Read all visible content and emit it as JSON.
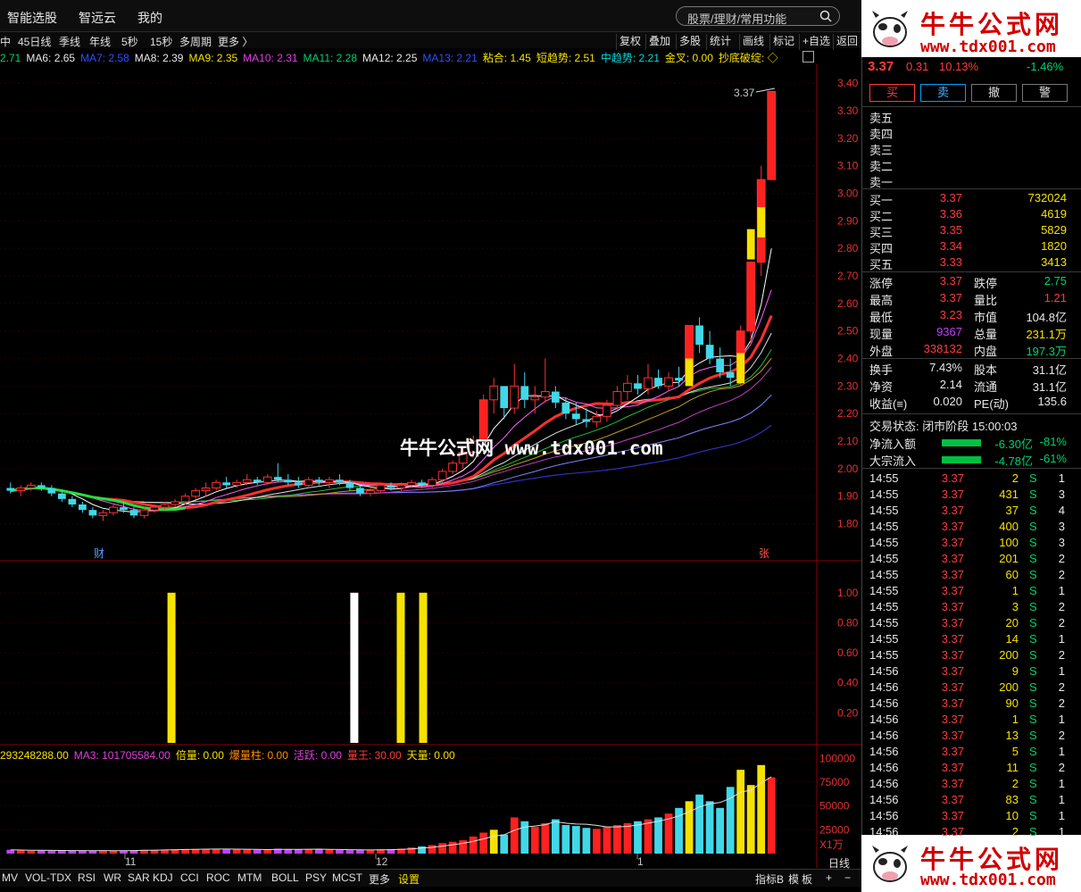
{
  "app": {
    "menus": [
      "智能选股",
      "智远云",
      "我的"
    ],
    "search_placeholder": "股票/理财/常用功能"
  },
  "periods": [
    "中",
    "45日线",
    "季线",
    "年线",
    "5秒",
    "15秒",
    "多周期",
    "更多 〉"
  ],
  "tools": [
    "复权",
    "叠加",
    "多股",
    "统计",
    "画线",
    "标记",
    "+自选",
    "返回"
  ],
  "ma_line": [
    {
      "text": "2.71",
      "color": "#00d070"
    },
    {
      "text": "MA6: 2.65",
      "color": "#e8e8e8"
    },
    {
      "text": "MA7: 2.58",
      "color": "#3050ff"
    },
    {
      "text": "MA8: 2.39",
      "color": "#e8e8e8"
    },
    {
      "text": "MA9: 2.35",
      "color": "#f5e200"
    },
    {
      "text": "MA10: 2.31",
      "color": "#e040e0"
    },
    {
      "text": "MA11: 2.28",
      "color": "#00d070"
    },
    {
      "text": "MA12: 2.25",
      "color": "#e8e8e8"
    },
    {
      "text": "MA13: 2.21",
      "color": "#3050ff"
    },
    {
      "text": "粘合: 1.45",
      "color": "#f5e200"
    },
    {
      "text": "短趋势: 2.51",
      "color": "#f5e200"
    },
    {
      "text": "中趋势: 2.21",
      "color": "#00d8d8"
    },
    {
      "text": "金叉: 0.00",
      "color": "#f5e200"
    },
    {
      "text": "抄底破绽: ◇",
      "color": "#f5e200"
    }
  ],
  "price_axis": [
    "3.40",
    "3.30",
    "3.20",
    "3.10",
    "3.00",
    "2.90",
    "2.80",
    "2.70",
    "2.60",
    "2.50",
    "2.40",
    "2.30",
    "2.20",
    "2.10",
    "2.00",
    "1.90",
    "1.80"
  ],
  "signal_axis": [
    "1.00",
    "0.80",
    "0.60",
    "0.40",
    "0.20"
  ],
  "volume_axis": [
    "100000",
    "75000",
    "50000",
    "25000"
  ],
  "volume_unit": "X1万",
  "high_label": "3.37",
  "markers": {
    "cai": "财",
    "zhang": "张"
  },
  "date_ticks": [
    "11",
    "12",
    "1"
  ],
  "vol_line": [
    {
      "text": "293248288.00",
      "color": "#f5e200"
    },
    {
      "text": "MA3: 101705584.00",
      "color": "#e040e0"
    },
    {
      "text": "倍量: 0.00",
      "color": "#f5e200"
    },
    {
      "text": "爆量柱: 0.00",
      "color": "#ff8c00"
    },
    {
      "text": "活跃: 0.00",
      "color": "#e040e0"
    },
    {
      "text": "量王: 30.00",
      "color": "#ff3b3b"
    },
    {
      "text": "天量: 0.00",
      "color": "#f5e200"
    }
  ],
  "bottom_tabs": [
    "MV",
    "VOL-TDX",
    "RSI",
    "WR",
    "SAR",
    "KDJ",
    "CCI",
    "ROC",
    "MTM",
    "BOLL",
    "PSY",
    "MCST",
    "更多",
    "设置"
  ],
  "bottom_right": [
    "指标B",
    "模",
    "板",
    "+",
    "−"
  ],
  "day_line": "日线",
  "watermark": "牛牛公式网 www.tdx001.com",
  "logo": {
    "cn": "牛牛公式网",
    "url": "www.tdx001.com"
  },
  "quote": {
    "price": "3.37",
    "change": "0.31",
    "pct": "10.13%",
    "other": "-1.46%"
  },
  "trade_buttons": [
    "买",
    "卖",
    "撤",
    "警"
  ],
  "asks": [
    "卖五",
    "卖四",
    "卖三",
    "卖二",
    "卖一"
  ],
  "bids": [
    {
      "label": "买一",
      "price": "3.37",
      "vol": "732024"
    },
    {
      "label": "买二",
      "price": "3.36",
      "vol": "4619"
    },
    {
      "label": "买三",
      "price": "3.35",
      "vol": "5829"
    },
    {
      "label": "买四",
      "price": "3.34",
      "vol": "1820"
    },
    {
      "label": "买五",
      "price": "3.33",
      "vol": "3413"
    }
  ],
  "stats": [
    {
      "l1": "涨停",
      "v1": "3.37",
      "c1": "red",
      "l2": "跌停",
      "v2": "2.75",
      "c2": "green"
    },
    {
      "l1": "最高",
      "v1": "3.37",
      "c1": "red",
      "l2": "量比",
      "v2": "1.21",
      "c2": "red"
    },
    {
      "l1": "最低",
      "v1": "3.23",
      "c1": "red",
      "l2": "市值",
      "v2": "104.8亿",
      "c2": "white"
    },
    {
      "l1": "现量",
      "v1": "9367",
      "c1": "purple",
      "l2": "总量",
      "v2": "231.1万",
      "c2": "yellow"
    },
    {
      "l1": "外盘",
      "v1": "338132",
      "c1": "red",
      "l2": "内盘",
      "v2": "197.3万",
      "c2": "green"
    }
  ],
  "stats2": [
    {
      "l1": "换手",
      "v1": "7.43%",
      "l2": "股本",
      "v2": "31.1亿"
    },
    {
      "l1": "净资",
      "v1": "2.14",
      "l2": "流通",
      "v2": "31.1亿"
    },
    {
      "l1": "收益(≡)",
      "v1": "0.020",
      "l2": "PE(动)",
      "v2": "135.6"
    }
  ],
  "trade_status": "交易状态: 闭市阶段 15:00:03",
  "flows": [
    {
      "label": "净流入额",
      "value": "-6.30亿",
      "pct": "-81%"
    },
    {
      "label": "大宗流入",
      "value": "-4.78亿",
      "pct": "-61%"
    }
  ],
  "ticks": [
    [
      "14:55",
      "3.37",
      "2",
      "S",
      "1"
    ],
    [
      "14:55",
      "3.37",
      "431",
      "S",
      "3"
    ],
    [
      "14:55",
      "3.37",
      "37",
      "S",
      "4"
    ],
    [
      "14:55",
      "3.37",
      "400",
      "S",
      "3"
    ],
    [
      "14:55",
      "3.37",
      "100",
      "S",
      "3"
    ],
    [
      "14:55",
      "3.37",
      "201",
      "S",
      "2"
    ],
    [
      "14:55",
      "3.37",
      "60",
      "S",
      "2"
    ],
    [
      "14:55",
      "3.37",
      "1",
      "S",
      "1"
    ],
    [
      "14:55",
      "3.37",
      "3",
      "S",
      "2"
    ],
    [
      "14:55",
      "3.37",
      "20",
      "S",
      "2"
    ],
    [
      "14:55",
      "3.37",
      "14",
      "S",
      "1"
    ],
    [
      "14:55",
      "3.37",
      "200",
      "S",
      "2"
    ],
    [
      "14:56",
      "3.37",
      "9",
      "S",
      "1"
    ],
    [
      "14:56",
      "3.37",
      "200",
      "S",
      "2"
    ],
    [
      "14:56",
      "3.37",
      "90",
      "S",
      "2"
    ],
    [
      "14:56",
      "3.37",
      "1",
      "S",
      "1"
    ],
    [
      "14:56",
      "3.37",
      "13",
      "S",
      "2"
    ],
    [
      "14:56",
      "3.37",
      "5",
      "S",
      "1"
    ],
    [
      "14:56",
      "3.37",
      "11",
      "S",
      "2"
    ],
    [
      "14:56",
      "3.37",
      "2",
      "S",
      "1"
    ],
    [
      "14:56",
      "3.37",
      "83",
      "S",
      "1"
    ],
    [
      "14:56",
      "3.37",
      "10",
      "S",
      "1"
    ],
    [
      "14:56",
      "3.37",
      "2",
      "S",
      "1"
    ]
  ],
  "chart_data": [
    {
      "type": "candlestick",
      "ylim": [
        1.75,
        3.42
      ],
      "candles": [
        [
          1.93,
          1.95,
          1.91,
          1.92
        ],
        [
          1.92,
          1.94,
          1.9,
          1.93
        ],
        [
          1.93,
          1.95,
          1.92,
          1.94
        ],
        [
          1.94,
          1.95,
          1.92,
          1.93
        ],
        [
          1.93,
          1.94,
          1.9,
          1.91
        ],
        [
          1.91,
          1.92,
          1.88,
          1.89
        ],
        [
          1.89,
          1.9,
          1.86,
          1.87
        ],
        [
          1.87,
          1.88,
          1.84,
          1.85
        ],
        [
          1.85,
          1.86,
          1.82,
          1.83
        ],
        [
          1.83,
          1.85,
          1.81,
          1.84
        ],
        [
          1.84,
          1.87,
          1.83,
          1.86
        ],
        [
          1.86,
          1.88,
          1.84,
          1.85
        ],
        [
          1.85,
          1.86,
          1.82,
          1.83
        ],
        [
          1.83,
          1.86,
          1.82,
          1.85
        ],
        [
          1.85,
          1.87,
          1.84,
          1.86
        ],
        [
          1.86,
          1.88,
          1.85,
          1.87
        ],
        [
          1.87,
          1.89,
          1.86,
          1.88
        ],
        [
          1.88,
          1.91,
          1.87,
          1.9
        ],
        [
          1.9,
          1.93,
          1.89,
          1.92
        ],
        [
          1.92,
          1.95,
          1.9,
          1.93
        ],
        [
          1.93,
          1.96,
          1.92,
          1.95
        ],
        [
          1.95,
          1.97,
          1.93,
          1.94
        ],
        [
          1.94,
          1.96,
          1.93,
          1.95
        ],
        [
          1.95,
          1.98,
          1.94,
          1.96
        ],
        [
          1.96,
          1.97,
          1.94,
          1.95
        ],
        [
          1.95,
          1.98,
          1.94,
          1.97
        ],
        [
          1.97,
          2.02,
          1.95,
          1.96
        ],
        [
          1.96,
          1.98,
          1.94,
          1.95
        ],
        [
          1.95,
          1.97,
          1.93,
          1.94
        ],
        [
          1.94,
          1.97,
          1.93,
          1.96
        ],
        [
          1.96,
          1.97,
          1.94,
          1.95
        ],
        [
          1.95,
          1.97,
          1.93,
          1.96
        ],
        [
          1.96,
          1.98,
          1.94,
          1.95
        ],
        [
          1.95,
          1.96,
          1.92,
          1.93
        ],
        [
          1.93,
          1.94,
          1.9,
          1.91
        ],
        [
          1.91,
          1.93,
          1.9,
          1.92
        ],
        [
          1.92,
          1.95,
          1.91,
          1.94
        ],
        [
          1.94,
          1.95,
          1.92,
          1.93
        ],
        [
          1.93,
          1.95,
          1.92,
          1.94
        ],
        [
          1.94,
          1.96,
          1.93,
          1.95
        ],
        [
          1.95,
          1.96,
          1.93,
          1.94
        ],
        [
          1.94,
          1.97,
          1.93,
          1.96
        ],
        [
          1.96,
          2.0,
          1.95,
          1.99
        ],
        [
          1.99,
          2.03,
          1.98,
          2.02
        ],
        [
          2.02,
          2.08,
          2.0,
          2.06
        ],
        [
          2.06,
          2.12,
          2.04,
          2.1
        ],
        [
          2.1,
          2.27,
          2.08,
          2.25
        ],
        [
          2.25,
          2.33,
          2.2,
          2.3
        ],
        [
          2.3,
          2.28,
          2.18,
          2.22
        ],
        [
          2.22,
          2.38,
          2.2,
          2.3
        ],
        [
          2.3,
          2.35,
          2.22,
          2.25
        ],
        [
          2.25,
          2.3,
          2.2,
          2.26
        ],
        [
          2.26,
          2.4,
          2.24,
          2.28
        ],
        [
          2.28,
          2.3,
          2.22,
          2.24
        ],
        [
          2.24,
          2.26,
          2.18,
          2.2
        ],
        [
          2.2,
          2.24,
          2.16,
          2.18
        ],
        [
          2.18,
          2.22,
          2.15,
          2.17
        ],
        [
          2.17,
          2.21,
          2.15,
          2.19
        ],
        [
          2.19,
          2.25,
          2.17,
          2.23
        ],
        [
          2.23,
          2.3,
          2.21,
          2.28
        ],
        [
          2.28,
          2.34,
          2.25,
          2.31
        ],
        [
          2.31,
          2.34,
          2.27,
          2.29
        ],
        [
          2.29,
          2.38,
          2.27,
          2.33
        ],
        [
          2.33,
          2.36,
          2.29,
          2.3
        ],
        [
          2.3,
          2.35,
          2.28,
          2.33
        ],
        [
          2.33,
          2.37,
          2.3,
          2.32
        ],
        [
          2.32,
          2.52,
          2.3,
          2.52
        ],
        [
          2.52,
          2.55,
          2.42,
          2.45
        ],
        [
          2.45,
          2.5,
          2.38,
          2.4
        ],
        [
          2.4,
          2.44,
          2.33,
          2.35
        ],
        [
          2.35,
          2.4,
          2.3,
          2.33
        ],
        [
          2.33,
          2.52,
          2.3,
          2.5
        ],
        [
          2.5,
          2.7,
          2.45,
          2.75
        ],
        [
          2.75,
          3.1,
          2.7,
          3.05
        ],
        [
          3.05,
          3.37,
          3.05,
          3.37
        ]
      ]
    },
    {
      "type": "bar",
      "values_index": [
        17,
        32,
        36,
        38
      ],
      "values": [
        1,
        1,
        1,
        1
      ],
      "colors": [
        "#f5e200",
        "#ffffff",
        "#f5e200",
        "#f5e200"
      ],
      "ylim": [
        0,
        1.1
      ]
    },
    {
      "type": "bar",
      "ylim": [
        0,
        105000
      ],
      "values": [
        4000,
        3500,
        3000,
        3200,
        3000,
        3500,
        3300,
        3000,
        2800,
        3200,
        3100,
        3400,
        3600,
        3900,
        4000,
        4200,
        4600,
        4800,
        4900,
        5000,
        4700,
        4500,
        4400,
        4200,
        4000,
        4100,
        5200,
        4800,
        4600,
        4500,
        4300,
        4100,
        3900,
        3600,
        3800,
        4000,
        4500,
        4800,
        5200,
        6500,
        7500,
        9000,
        11000,
        12500,
        14000,
        18000,
        22000,
        25000,
        20000,
        38000,
        34000,
        28000,
        32000,
        36000,
        30000,
        29000,
        27000,
        26000,
        28000,
        30000,
        32000,
        34000,
        36000,
        38000,
        42000,
        48000,
        55000,
        62000,
        55000,
        48000,
        70000,
        88000,
        72000,
        93000,
        80000
      ]
    }
  ]
}
